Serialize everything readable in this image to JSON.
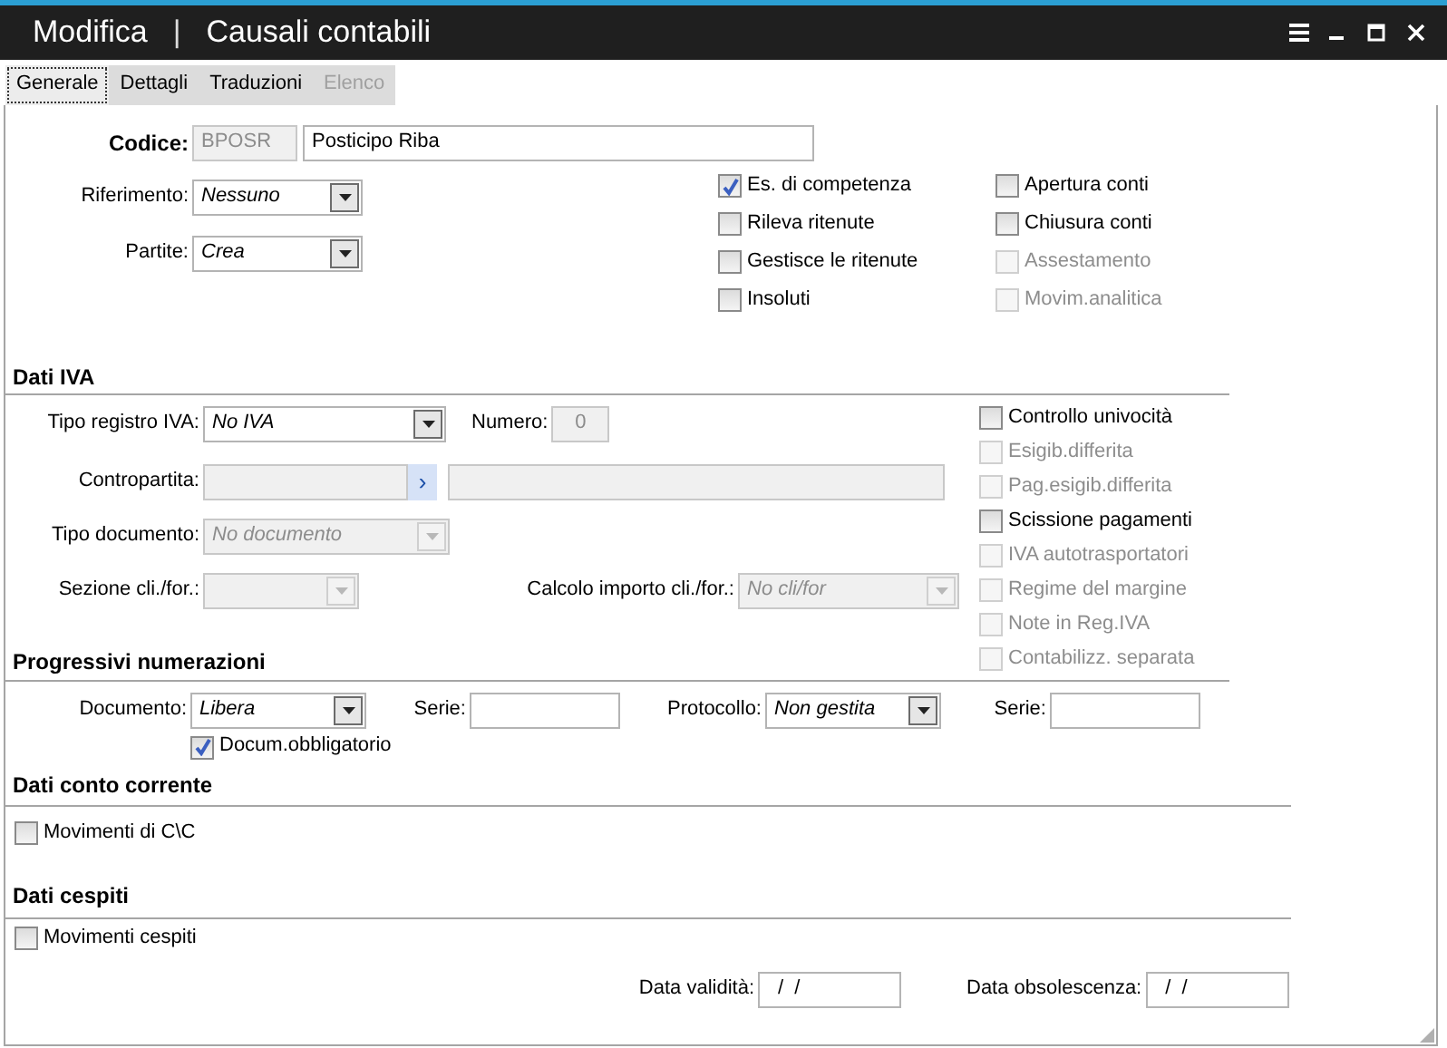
{
  "window": {
    "mode": "Modifica",
    "separator": "|",
    "title": "Causali contabili"
  },
  "tabs": [
    {
      "label": "Generale",
      "selected": true,
      "disabled": false
    },
    {
      "label": "Dettagli",
      "selected": false,
      "disabled": false
    },
    {
      "label": "Traduzioni",
      "selected": false,
      "disabled": false
    },
    {
      "label": "Elenco",
      "selected": false,
      "disabled": true
    }
  ],
  "codice": {
    "label": "Codice:",
    "code": "BPOSR",
    "description": "Posticipo Riba"
  },
  "selectors": [
    {
      "label": "Riferimento:",
      "value": "Nessuno",
      "disabled": false
    },
    {
      "label": "Partite:",
      "value": "Crea",
      "disabled": false
    }
  ],
  "options": [
    {
      "label": "Es. di competenza",
      "checked": true,
      "disabled": false
    },
    {
      "label": "Rileva ritenute",
      "checked": false,
      "disabled": false
    },
    {
      "label": "Gestisce le ritenute",
      "checked": false,
      "disabled": false
    },
    {
      "label": "Insoluti",
      "checked": false,
      "disabled": false
    },
    {
      "label": "Apertura conti",
      "checked": false,
      "disabled": false
    },
    {
      "label": "Chiusura conti",
      "checked": false,
      "disabled": false
    },
    {
      "label": "Assestamento",
      "checked": false,
      "disabled": true
    },
    {
      "label": "Movim.analitica",
      "checked": false,
      "disabled": true
    }
  ],
  "dati_iva": {
    "title": "Dati IVA",
    "tipo_registro": {
      "label": "Tipo registro IVA:",
      "value": "No IVA",
      "disabled": false
    },
    "numero": {
      "label": "Numero:",
      "value": "0",
      "disabled": true
    },
    "contropartita": {
      "label": "Contropartita:",
      "button": "›",
      "disabled": true
    },
    "tipo_documento": {
      "label": "Tipo documento:",
      "value": "No documento",
      "disabled": true
    },
    "sezione": {
      "label": "Sezione cli./for.:",
      "disabled": true
    },
    "calcolo_importo": {
      "label": "Calcolo importo cli./for.:",
      "value": "No cli/for",
      "disabled": true
    },
    "options": [
      {
        "label": "Controllo univocità",
        "checked": false,
        "disabled": false
      },
      {
        "label": "Esigib.differita",
        "checked": false,
        "disabled": true
      },
      {
        "label": "Pag.esigib.differita",
        "checked": false,
        "disabled": true
      },
      {
        "label": "Scissione pagamenti",
        "checked": false,
        "disabled": false
      },
      {
        "label": "IVA autotrasportatori",
        "checked": false,
        "disabled": true
      },
      {
        "label": "Regime del margine",
        "checked": false,
        "disabled": true
      },
      {
        "label": "Note in Reg.IVA",
        "checked": false,
        "disabled": true
      },
      {
        "label": "Contabilizz. separata",
        "checked": false,
        "disabled": true
      }
    ]
  },
  "progressivi": {
    "title": "Progressivi numerazioni",
    "documento": {
      "label": "Documento:",
      "value": "Libera",
      "disabled": false
    },
    "serie": {
      "label": "Serie:"
    },
    "protocollo": {
      "label": "Protocollo:",
      "value": "Non gestita",
      "disabled": false
    },
    "serie_protocollo": {
      "label": "Serie:"
    },
    "documento_obbligatorio": {
      "label": "Docum.obbligatorio",
      "checked": true,
      "disabled": false
    }
  },
  "conto_corrente": {
    "title": "Dati conto corrente",
    "option": {
      "label": "Movimenti di C\\C",
      "checked": false,
      "disabled": false
    }
  },
  "cespiti": {
    "title": "Dati cespiti",
    "option": {
      "label": "Movimenti cespiti",
      "checked": false,
      "disabled": false
    },
    "data_validita": {
      "label": "Data validità:",
      "value": "/  /"
    },
    "data_obsolescenza": {
      "label": "Data obsolescenza:",
      "value": "/  /"
    }
  }
}
